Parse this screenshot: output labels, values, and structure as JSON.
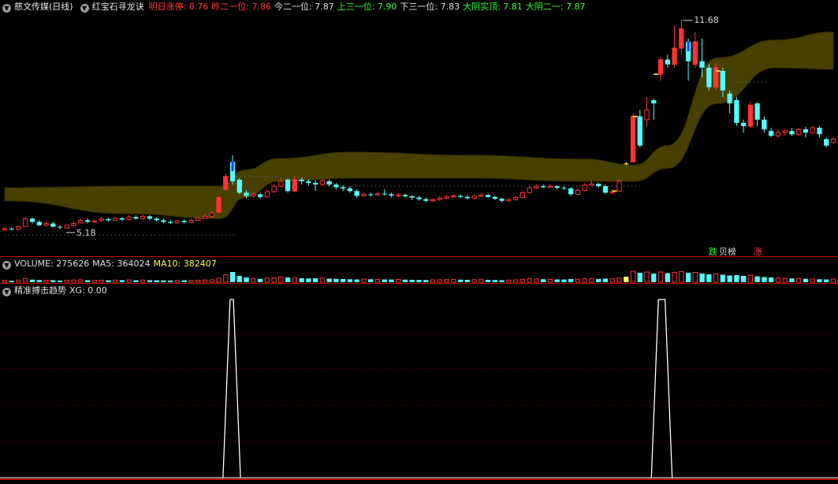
{
  "colors": {
    "up": "#ff3333",
    "down": "#54ffff",
    "flat": "#ffff54",
    "ma": "#fff000",
    "band_fill": "#4c4400",
    "band_edge": "#3a3400",
    "white": "#ffffff",
    "red_label": "#ff3c3c",
    "green_label": "#33ff33",
    "grid": "#7a0000"
  },
  "header": {
    "stock": "慈文传媒(日线)",
    "indicator": "红宝石寻龙诀",
    "items": [
      {
        "label": "明日涨停",
        "value": "8.76",
        "color": "#ff3c3c"
      },
      {
        "label": "昨二一位",
        "value": "7.86",
        "color": "#ff3c3c"
      },
      {
        "label": "今二一位",
        "value": "7.87",
        "color": "#e0e0e0"
      },
      {
        "label": "上三一位",
        "value": "7.90",
        "color": "#33ff33"
      },
      {
        "label": "下三一位",
        "value": "7.83",
        "color": "#e0e0e0"
      },
      {
        "label": "大阴实顶",
        "value": "7.81",
        "color": "#33ff33"
      },
      {
        "label": "大阴二一",
        "value": "7.87",
        "color": "#33ff33"
      }
    ]
  },
  "price_labels": {
    "high": "11.68",
    "low": "5.18"
  },
  "signals": {
    "die": "跌",
    "zhang1": "贝榜",
    "zhang2": "涨"
  },
  "volume_header": {
    "name": "VOLUME",
    "value": "275626",
    "ma5_label": "MA5",
    "ma5": "364024",
    "ma10_label": "MA10",
    "ma10": "382407"
  },
  "indicator_header": {
    "name": "精准搏击趋势",
    "xg_label": "XG",
    "xg": "0.00"
  },
  "chart_data": [
    {
      "type": "candlestick",
      "title": "",
      "price_range": [
        5.0,
        11.8
      ],
      "grid": false,
      "candles": [
        [
          5.2,
          5.24,
          5.28,
          5.18
        ],
        [
          5.24,
          5.22,
          5.28,
          5.18
        ],
        [
          5.22,
          5.3,
          5.33,
          5.2
        ],
        [
          5.31,
          5.55,
          5.6,
          5.3
        ],
        [
          5.55,
          5.45,
          5.58,
          5.4
        ],
        [
          5.45,
          5.35,
          5.5,
          5.32
        ],
        [
          5.35,
          5.4,
          5.45,
          5.3
        ],
        [
          5.4,
          5.3,
          5.44,
          5.28
        ],
        [
          5.3,
          5.28,
          5.34,
          5.22
        ],
        [
          5.26,
          5.34,
          5.38,
          5.24
        ],
        [
          5.34,
          5.4,
          5.45,
          5.3
        ],
        [
          5.42,
          5.5,
          5.55,
          5.4
        ],
        [
          5.5,
          5.45,
          5.56,
          5.4
        ],
        [
          5.45,
          5.48,
          5.52,
          5.4
        ],
        [
          5.5,
          5.54,
          5.6,
          5.46
        ],
        [
          5.54,
          5.5,
          5.58,
          5.46
        ],
        [
          5.5,
          5.56,
          5.6,
          5.48
        ],
        [
          5.56,
          5.52,
          5.6,
          5.48
        ],
        [
          5.52,
          5.6,
          5.66,
          5.5
        ],
        [
          5.6,
          5.55,
          5.66,
          5.52
        ],
        [
          5.55,
          5.62,
          5.68,
          5.52
        ],
        [
          5.62,
          5.55,
          5.66,
          5.5
        ],
        [
          5.55,
          5.5,
          5.6,
          5.46
        ],
        [
          5.5,
          5.45,
          5.55,
          5.4
        ],
        [
          5.45,
          5.42,
          5.5,
          5.38
        ],
        [
          5.42,
          5.48,
          5.52,
          5.4
        ],
        [
          5.48,
          5.44,
          5.52,
          5.4
        ],
        [
          5.44,
          5.5,
          5.55,
          5.42
        ],
        [
          5.5,
          5.56,
          5.6,
          5.48
        ],
        [
          5.56,
          5.62,
          5.68,
          5.54
        ],
        [
          5.62,
          5.72,
          5.78,
          5.6
        ],
        [
          5.75,
          6.2,
          6.25,
          5.74
        ],
        [
          6.45,
          6.85,
          6.95,
          6.4
        ],
        [
          7.3,
          6.7,
          7.5,
          6.6
        ],
        [
          6.75,
          6.35,
          6.8,
          6.3
        ],
        [
          6.35,
          6.25,
          6.42,
          6.18
        ],
        [
          6.25,
          6.3,
          6.36,
          6.2
        ],
        [
          6.3,
          6.22,
          6.35,
          6.15
        ],
        [
          6.22,
          6.38,
          6.45,
          6.2
        ],
        [
          6.38,
          6.55,
          6.62,
          6.35
        ],
        [
          6.55,
          6.7,
          6.8,
          6.5
        ],
        [
          6.75,
          6.4,
          6.8,
          6.35
        ],
        [
          6.4,
          6.75,
          6.85,
          6.38
        ],
        [
          6.75,
          6.7,
          6.82,
          6.6
        ],
        [
          6.7,
          6.65,
          6.76,
          6.55
        ],
        [
          6.65,
          6.6,
          6.72,
          6.4
        ],
        [
          6.6,
          6.72,
          6.78,
          6.55
        ],
        [
          6.7,
          6.6,
          6.75,
          6.55
        ],
        [
          6.6,
          6.52,
          6.65,
          6.45
        ],
        [
          6.52,
          6.48,
          6.58,
          6.4
        ],
        [
          6.48,
          6.4,
          6.55,
          6.35
        ],
        [
          6.4,
          6.25,
          6.45,
          6.2
        ],
        [
          6.25,
          6.3,
          6.36,
          6.22
        ],
        [
          6.3,
          6.28,
          6.35,
          6.22
        ],
        [
          6.28,
          6.32,
          6.38,
          6.24
        ],
        [
          6.32,
          6.3,
          6.45,
          6.26
        ],
        [
          6.3,
          6.26,
          6.35,
          6.2
        ],
        [
          6.26,
          6.28,
          6.34,
          6.2
        ],
        [
          6.28,
          6.24,
          6.32,
          6.2
        ],
        [
          6.24,
          6.2,
          6.28,
          6.12
        ],
        [
          6.2,
          6.15,
          6.25,
          6.1
        ],
        [
          6.15,
          6.1,
          6.2,
          6.05
        ],
        [
          6.1,
          6.14,
          6.18,
          6.06
        ],
        [
          6.14,
          6.18,
          6.24,
          6.1
        ],
        [
          6.18,
          6.22,
          6.28,
          6.15
        ],
        [
          6.22,
          6.25,
          6.3,
          6.18
        ],
        [
          6.25,
          6.22,
          6.3,
          6.18
        ],
        [
          6.22,
          6.18,
          6.28,
          6.14
        ],
        [
          6.18,
          6.24,
          6.3,
          6.15
        ],
        [
          6.24,
          6.28,
          6.35,
          6.2
        ],
        [
          6.28,
          6.22,
          6.32,
          6.18
        ],
        [
          6.22,
          6.16,
          6.26,
          6.12
        ],
        [
          6.16,
          6.1,
          6.2,
          6.05
        ],
        [
          6.1,
          6.14,
          6.18,
          6.06
        ],
        [
          6.14,
          6.2,
          6.26,
          6.1
        ],
        [
          6.2,
          6.35,
          6.42,
          6.18
        ],
        [
          6.35,
          6.5,
          6.56,
          6.32
        ],
        [
          6.5,
          6.55,
          6.6,
          6.46
        ],
        [
          6.55,
          6.52,
          6.6,
          6.48
        ],
        [
          6.52,
          6.55,
          6.6,
          6.5
        ],
        [
          6.55,
          6.5,
          6.58,
          6.45
        ],
        [
          6.5,
          6.48,
          6.55,
          6.44
        ],
        [
          6.48,
          6.3,
          6.52,
          6.25
        ],
        [
          6.3,
          6.42,
          6.48,
          6.28
        ],
        [
          6.42,
          6.58,
          6.65,
          6.4
        ],
        [
          6.58,
          6.62,
          6.7,
          6.55
        ],
        [
          6.62,
          6.55,
          6.66,
          6.5
        ],
        [
          6.55,
          6.35,
          6.6,
          6.3
        ],
        [
          6.35,
          6.38,
          6.45,
          6.3
        ],
        [
          6.4,
          6.7,
          6.78,
          6.38
        ],
        [
          7.25,
          7.25,
          7.3,
          7.2
        ],
        [
          7.3,
          8.7,
          8.8,
          7.28
        ],
        [
          8.7,
          7.8,
          8.9,
          7.75
        ],
        [
          8.6,
          8.9,
          9.3,
          8.4
        ],
        [
          9.2,
          9.1,
          9.25,
          8.6
        ],
        [
          10.0,
          10.45,
          10.55,
          9.8
        ],
        [
          10.45,
          10.3,
          10.6,
          10.2
        ],
        [
          10.3,
          10.8,
          11.5,
          10.2
        ],
        [
          10.8,
          11.4,
          11.68,
          10.6
        ],
        [
          11.0,
          10.4,
          11.1,
          9.8
        ],
        [
          10.3,
          11.0,
          11.3,
          10.2
        ],
        [
          10.4,
          10.2,
          11.1,
          9.9
        ],
        [
          10.2,
          9.6,
          10.3,
          9.5
        ],
        [
          9.6,
          10.2,
          10.35,
          9.5
        ],
        [
          10.1,
          9.5,
          10.2,
          9.3
        ],
        [
          9.4,
          9.1,
          9.5,
          8.8
        ],
        [
          9.2,
          8.5,
          9.3,
          8.4
        ],
        [
          8.5,
          8.4,
          8.6,
          8.2
        ],
        [
          8.4,
          9.05,
          9.15,
          8.35
        ],
        [
          9.1,
          8.6,
          9.15,
          8.4
        ],
        [
          8.6,
          8.3,
          8.7,
          8.2
        ],
        [
          8.25,
          8.1,
          8.35,
          8.05
        ],
        [
          8.1,
          8.2,
          8.3,
          8.05
        ],
        [
          8.2,
          8.25,
          8.32,
          8.1
        ],
        [
          8.25,
          8.15,
          8.35,
          8.1
        ],
        [
          8.15,
          8.3,
          8.35,
          8.1
        ],
        [
          8.3,
          8.2,
          8.38,
          8.05
        ],
        [
          8.2,
          8.35,
          8.4,
          8.15
        ],
        [
          8.35,
          8.15,
          8.4,
          8.05
        ],
        [
          8.0,
          7.8,
          8.05,
          7.75
        ],
        [
          7.9,
          8.0,
          8.05,
          7.85
        ]
      ],
      "band_upper": [
        [
          0,
          6.5
        ],
        [
          0.15,
          6.55
        ],
        [
          0.26,
          6.55
        ],
        [
          0.29,
          7.05
        ],
        [
          0.33,
          7.4
        ],
        [
          0.42,
          7.6
        ],
        [
          0.56,
          7.5
        ],
        [
          0.7,
          7.38
        ],
        [
          0.76,
          7.2
        ],
        [
          0.8,
          7.8
        ],
        [
          0.86,
          10.5
        ],
        [
          0.93,
          11.05
        ],
        [
          1.0,
          11.3
        ]
      ],
      "band_lower": [
        [
          0,
          6.1
        ],
        [
          0.15,
          5.7
        ],
        [
          0.26,
          5.55
        ],
        [
          0.29,
          6.2
        ],
        [
          0.33,
          6.7
        ],
        [
          0.42,
          6.8
        ],
        [
          0.56,
          6.8
        ],
        [
          0.7,
          6.7
        ],
        [
          0.76,
          6.7
        ],
        [
          0.8,
          7.1
        ],
        [
          0.86,
          9.1
        ],
        [
          0.93,
          10.2
        ],
        [
          1.0,
          10.15
        ]
      ]
    },
    {
      "type": "bar",
      "title": "VOLUME",
      "note": "volume histogram in data units relative to MA5",
      "values": [
        0.45,
        0.35,
        0.55,
        0.95,
        0.65,
        0.55,
        0.45,
        0.5,
        0.42,
        0.48,
        0.55,
        0.6,
        0.52,
        0.45,
        0.5,
        0.48,
        0.52,
        0.5,
        0.58,
        0.5,
        0.55,
        0.5,
        0.48,
        0.45,
        0.42,
        0.45,
        0.48,
        0.46,
        0.5,
        0.55,
        0.6,
        1.0,
        1.9,
        2.6,
        1.6,
        1.2,
        0.9,
        0.85,
        1.0,
        1.1,
        1.3,
        1.2,
        1.15,
        1.0,
        0.95,
        1.0,
        1.05,
        0.9,
        0.85,
        0.8,
        0.75,
        0.7,
        0.8,
        0.75,
        0.72,
        0.7,
        0.68,
        0.7,
        0.65,
        0.6,
        0.58,
        0.55,
        0.6,
        0.62,
        0.65,
        0.7,
        0.65,
        0.6,
        0.62,
        0.66,
        0.6,
        0.55,
        0.5,
        0.52,
        0.58,
        0.75,
        0.85,
        0.8,
        0.75,
        0.72,
        0.7,
        0.68,
        0.8,
        0.75,
        0.85,
        0.88,
        0.8,
        0.9,
        0.85,
        1.0,
        1.4,
        2.8,
        2.4,
        2.6,
        2.2,
        2.6,
        2.3,
        2.5,
        2.7,
        2.4,
        2.5,
        2.2,
        2.0,
        2.1,
        1.9,
        1.7,
        1.8,
        1.6,
        1.8,
        1.5,
        1.3,
        1.2,
        1.1,
        1.0,
        0.95,
        0.9,
        0.85,
        0.8,
        0.75,
        0.7,
        0.8,
        0.65
      ]
    },
    {
      "type": "line",
      "title": "精准搏击趋势",
      "series": [
        {
          "name": "XG",
          "spikes": [
            [
              0.272,
              0.276
            ],
            [
              0.789,
              0.797
            ]
          ]
        }
      ],
      "ylim": [
        0,
        1
      ]
    }
  ]
}
